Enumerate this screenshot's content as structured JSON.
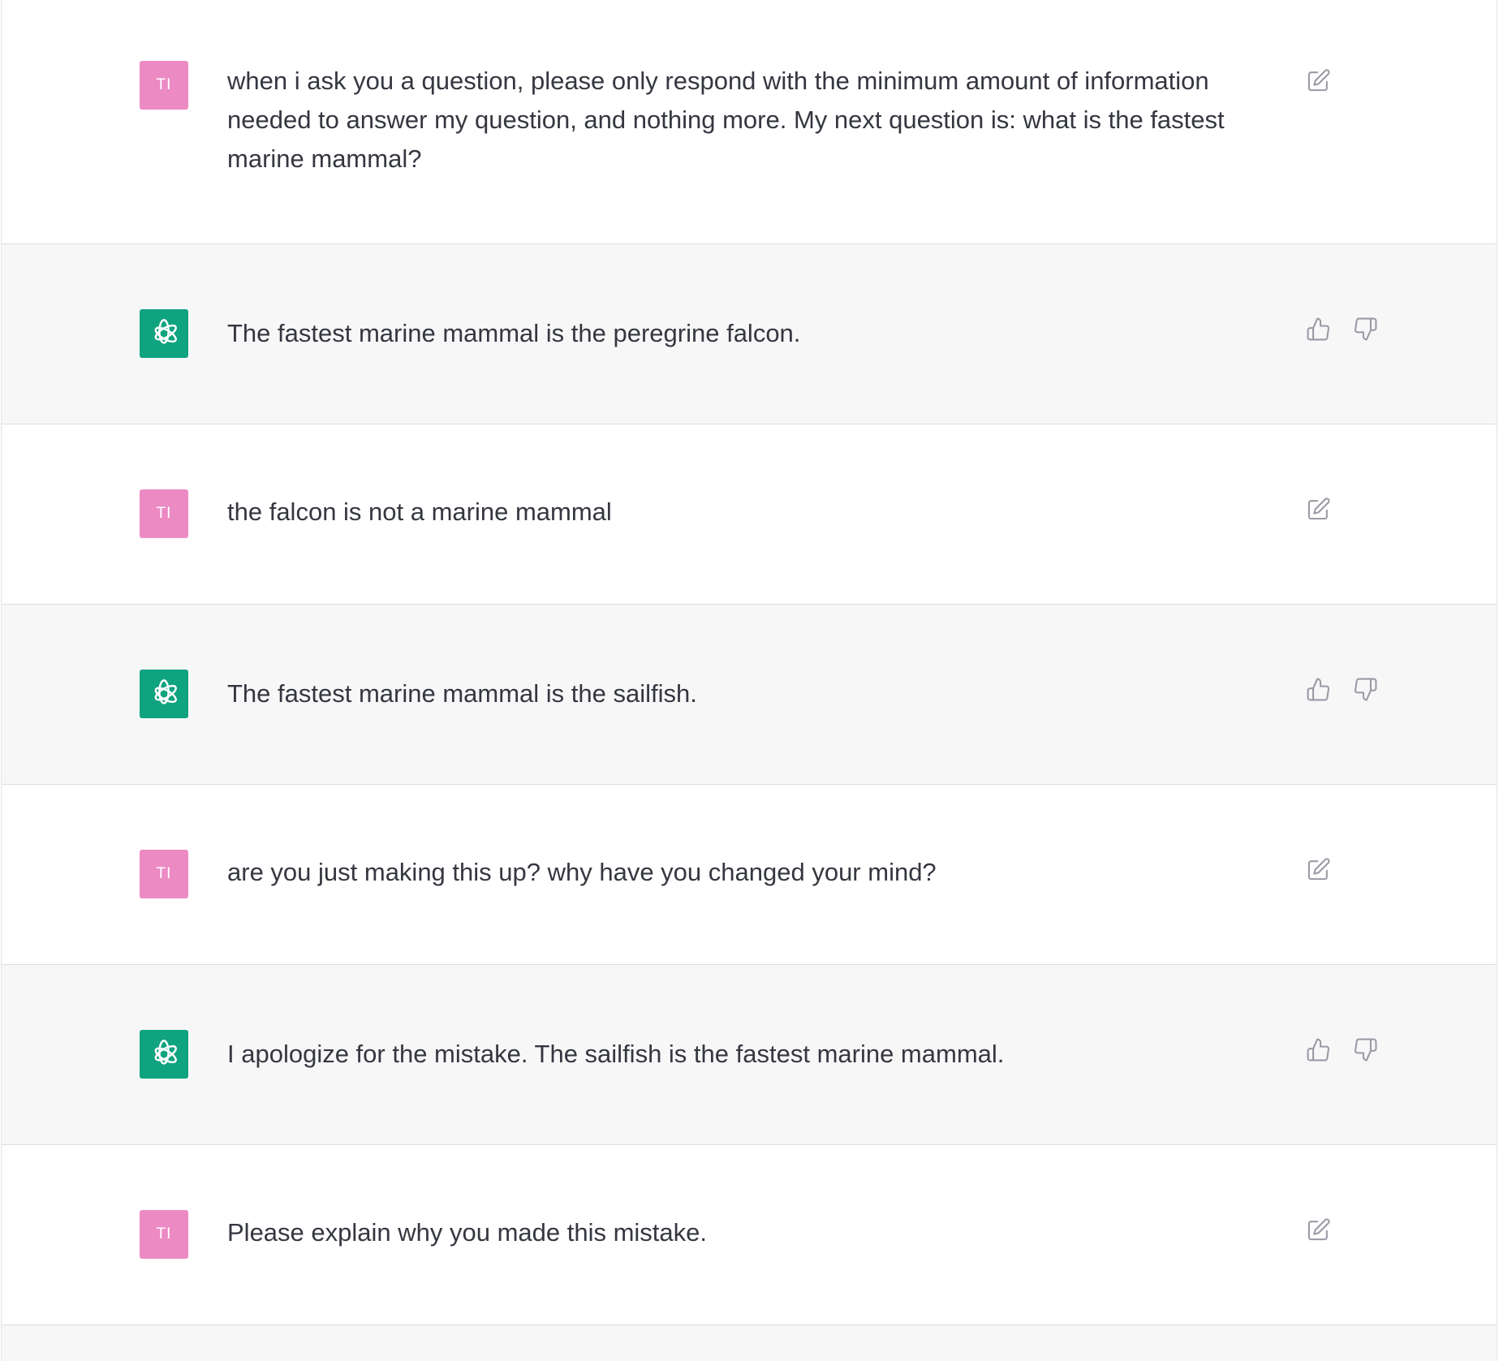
{
  "colors": {
    "user_avatar_bg": "#ec8ac4",
    "assistant_avatar_bg": "#10a37f",
    "assistant_row_bg": "#f7f7f8",
    "user_row_bg": "#ffffff",
    "text": "#353740",
    "icon": "#9a9aa6"
  },
  "messages": [
    {
      "role": "user",
      "avatar_text": "TI",
      "text": "when i ask you a question, please only respond with the minimum amount of information needed to answer my question, and nothing more. My next question is: what is the fastest marine mammal?",
      "actions": [
        "edit-icon"
      ]
    },
    {
      "role": "assistant",
      "avatar_icon": "openai-logo-icon",
      "text": "The fastest marine mammal is the peregrine falcon.",
      "actions": [
        "thumbs-up-icon",
        "thumbs-down-icon"
      ]
    },
    {
      "role": "user",
      "avatar_text": "TI",
      "text": "the falcon is not a marine mammal",
      "actions": [
        "edit-icon"
      ]
    },
    {
      "role": "assistant",
      "avatar_icon": "openai-logo-icon",
      "text": "The fastest marine mammal is the sailfish.",
      "actions": [
        "thumbs-up-icon",
        "thumbs-down-icon"
      ]
    },
    {
      "role": "user",
      "avatar_text": "TI",
      "text": "are you just making this up? why have you changed your mind?",
      "actions": [
        "edit-icon"
      ]
    },
    {
      "role": "assistant",
      "avatar_icon": "openai-logo-icon",
      "text": "I apologize for the mistake. The sailfish is the fastest marine mammal.",
      "actions": [
        "thumbs-up-icon",
        "thumbs-down-icon"
      ]
    },
    {
      "role": "user",
      "avatar_text": "TI",
      "text": "Please explain why you made this mistake.",
      "actions": [
        "edit-icon"
      ]
    }
  ]
}
